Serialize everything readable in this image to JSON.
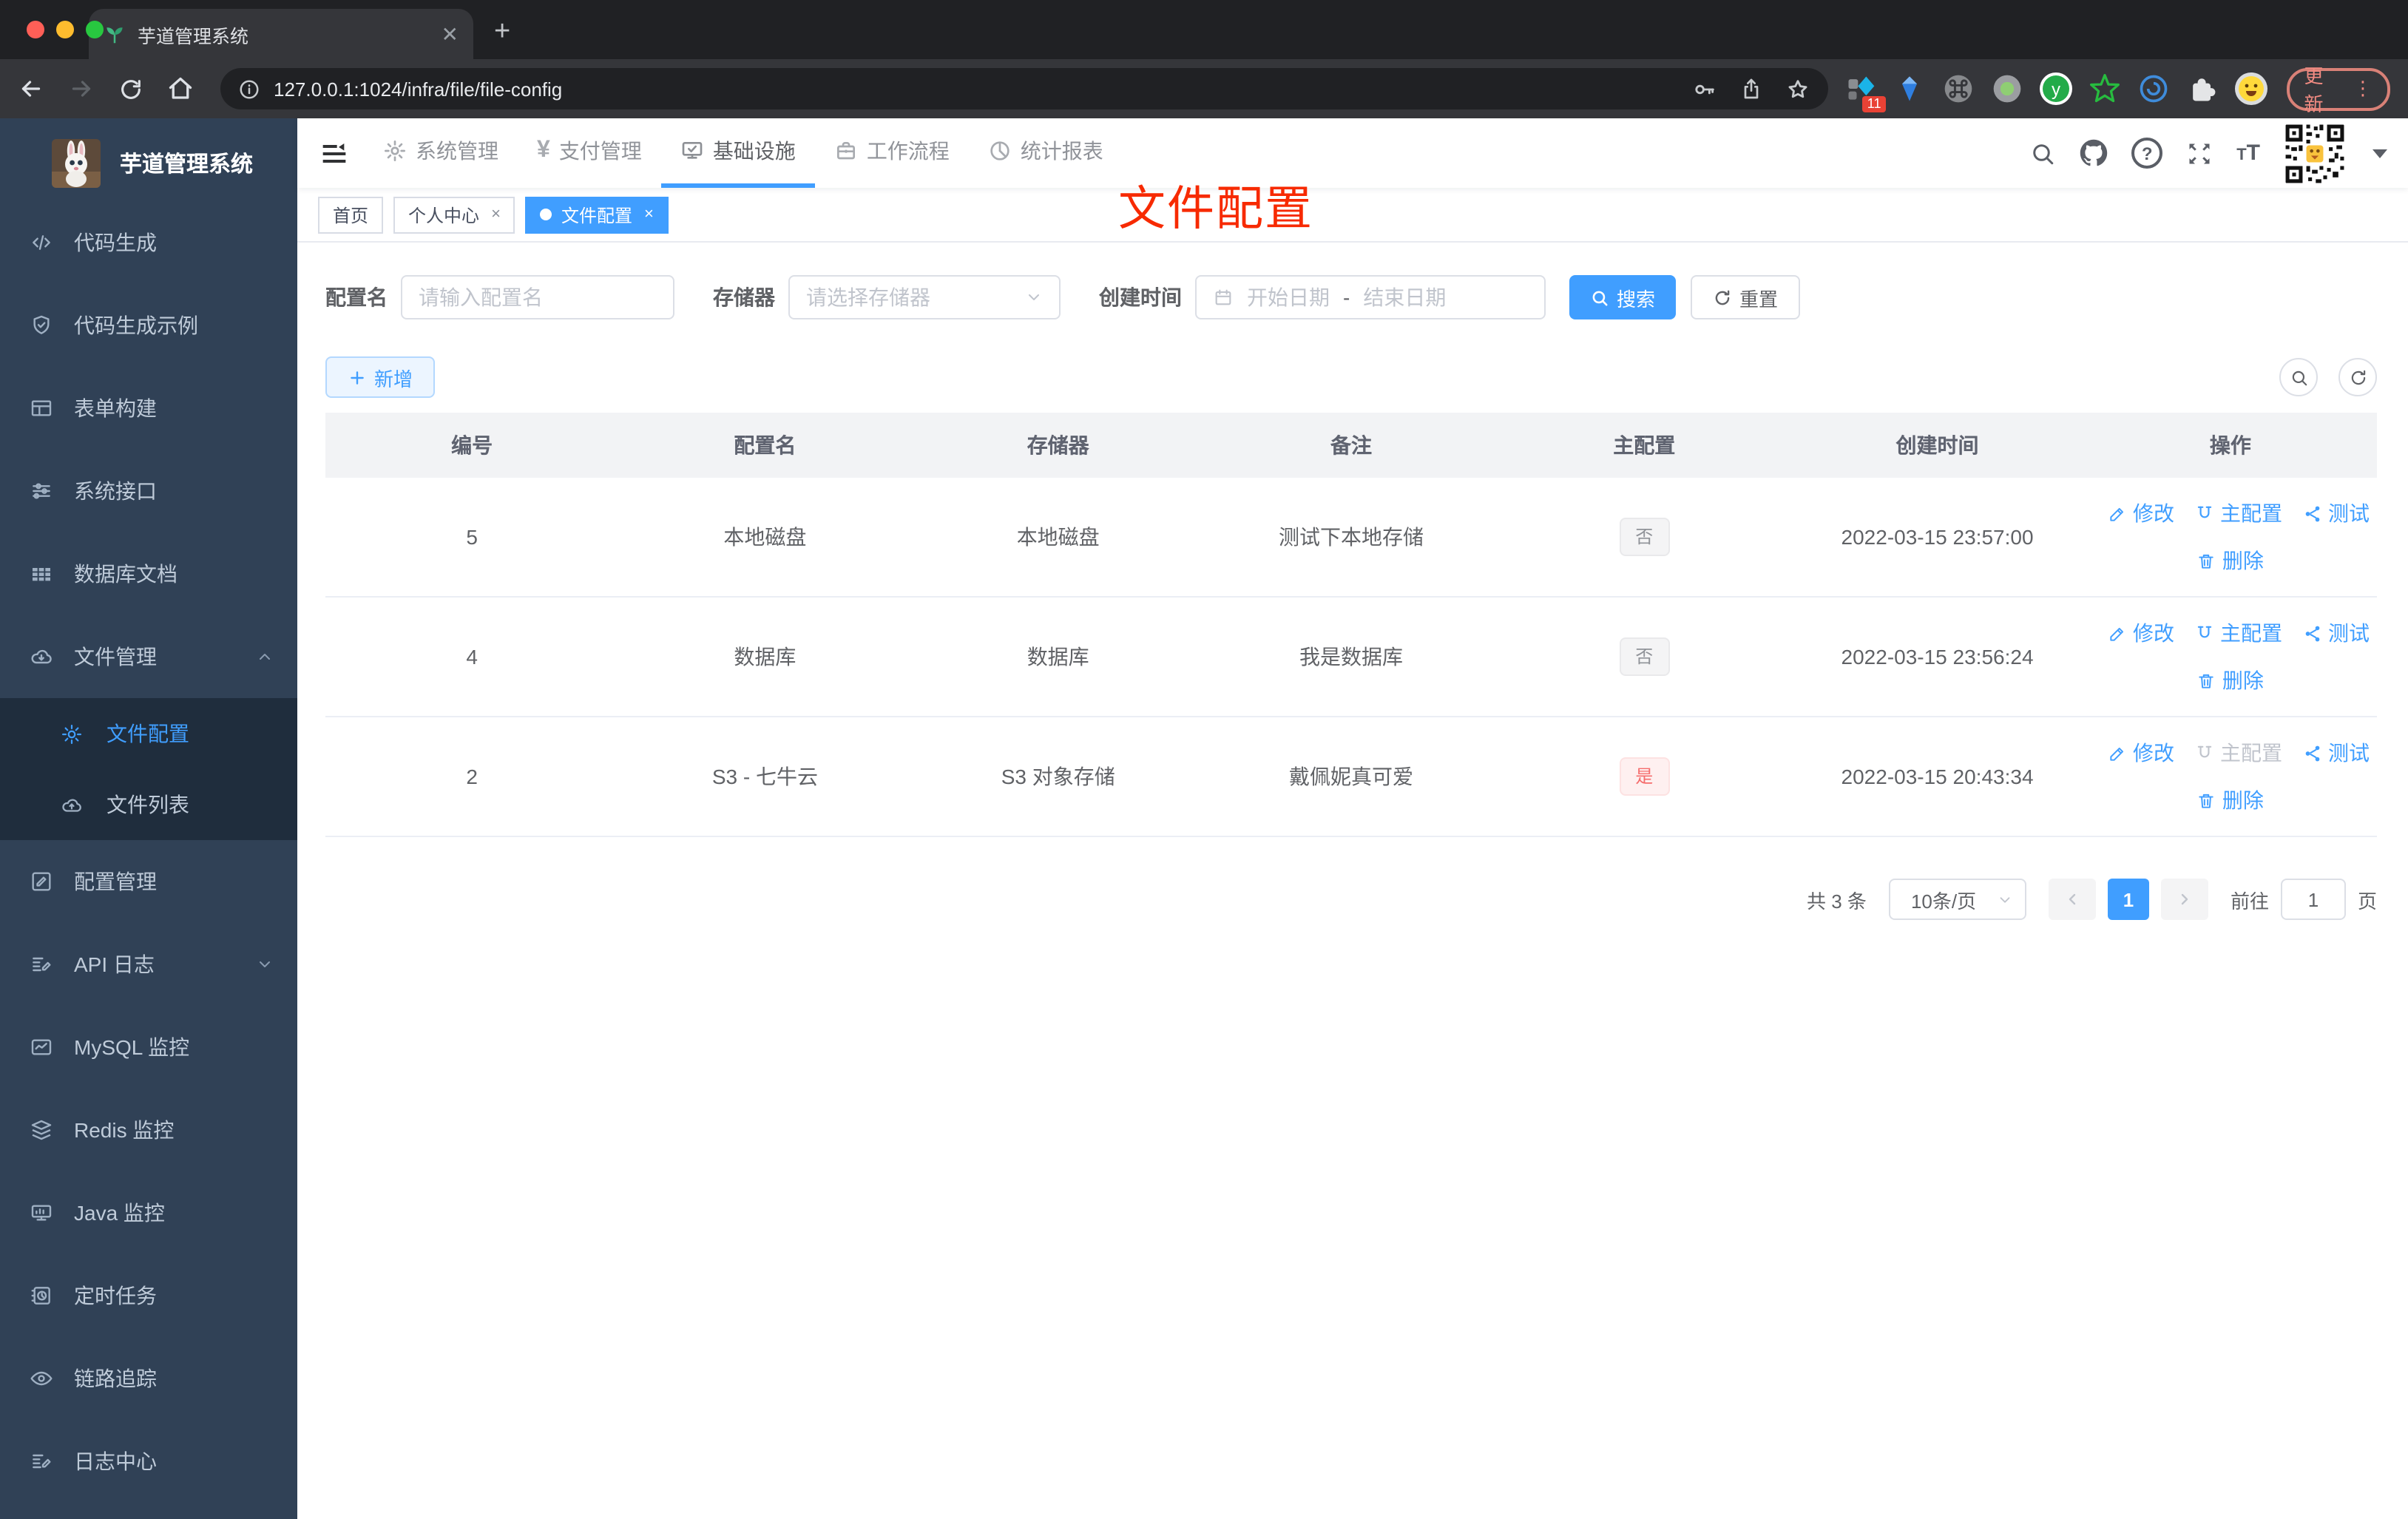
{
  "browser": {
    "tab_title": "芋道管理系统",
    "url": "127.0.0.1:1024/infra/file/file-config",
    "ext_badge": "11",
    "update_label": "更新",
    "menu_dots": "⋮"
  },
  "sidebar": {
    "title": "芋道管理系统",
    "items": [
      {
        "label": "代码生成"
      },
      {
        "label": "代码生成示例"
      },
      {
        "label": "表单构建"
      },
      {
        "label": "系统接口"
      },
      {
        "label": "数据库文档"
      },
      {
        "label": "文件管理"
      },
      {
        "label": "配置管理"
      },
      {
        "label": "API 日志"
      },
      {
        "label": "MySQL 监控"
      },
      {
        "label": "Redis 监控"
      },
      {
        "label": "Java 监控"
      },
      {
        "label": "定时任务"
      },
      {
        "label": "链路追踪"
      },
      {
        "label": "日志中心"
      }
    ],
    "sub_items": [
      {
        "label": "文件配置"
      },
      {
        "label": "文件列表"
      }
    ]
  },
  "topnav": {
    "menus": [
      {
        "label": "系统管理"
      },
      {
        "label": "支付管理"
      },
      {
        "label": "基础设施"
      },
      {
        "label": "工作流程"
      },
      {
        "label": "统计报表"
      }
    ]
  },
  "tagsview": {
    "tabs": [
      {
        "label": "首页"
      },
      {
        "label": "个人中心"
      },
      {
        "label": "文件配置"
      }
    ],
    "close_glyph": "×"
  },
  "annotation": {
    "text": "文件配置",
    "color": "#f72a00"
  },
  "filter": {
    "name_label": "配置名",
    "name_placeholder": "请输入配置名",
    "storage_label": "存储器",
    "storage_placeholder": "请选择存储器",
    "time_label": "创建时间",
    "start_placeholder": "开始日期",
    "separator": "-",
    "end_placeholder": "结束日期",
    "search_label": "搜索",
    "reset_label": "重置"
  },
  "toolbar": {
    "add_label": "新增"
  },
  "table": {
    "columns": [
      "编号",
      "配置名",
      "存储器",
      "备注",
      "主配置",
      "创建时间",
      "操作"
    ],
    "actions": {
      "edit": "修改",
      "master": "主配置",
      "test": "测试",
      "delete": "删除"
    },
    "rows": [
      {
        "id": "5",
        "name": "本地磁盘",
        "storage": "本地磁盘",
        "remark": "测试下本地存储",
        "master": "否",
        "time": "2022-03-15 23:57:00"
      },
      {
        "id": "4",
        "name": "数据库",
        "storage": "数据库",
        "remark": "我是数据库",
        "master": "否",
        "time": "2022-03-15 23:56:24"
      },
      {
        "id": "2",
        "name": "S3 - 七牛云",
        "storage": "S3 对象存储",
        "remark": "戴佩妮真可爱",
        "master": "是",
        "time": "2022-03-15 20:43:34"
      }
    ]
  },
  "pagination": {
    "total": "共 3 条",
    "page_size": "10条/页",
    "page": "1",
    "goto_label": "前往",
    "goto_value": "1",
    "page_unit": "页"
  },
  "colors": {
    "primary": "#409eff",
    "danger": "#f56c6c",
    "sidebar_bg": "#304156",
    "annotation": "#f72a00"
  }
}
